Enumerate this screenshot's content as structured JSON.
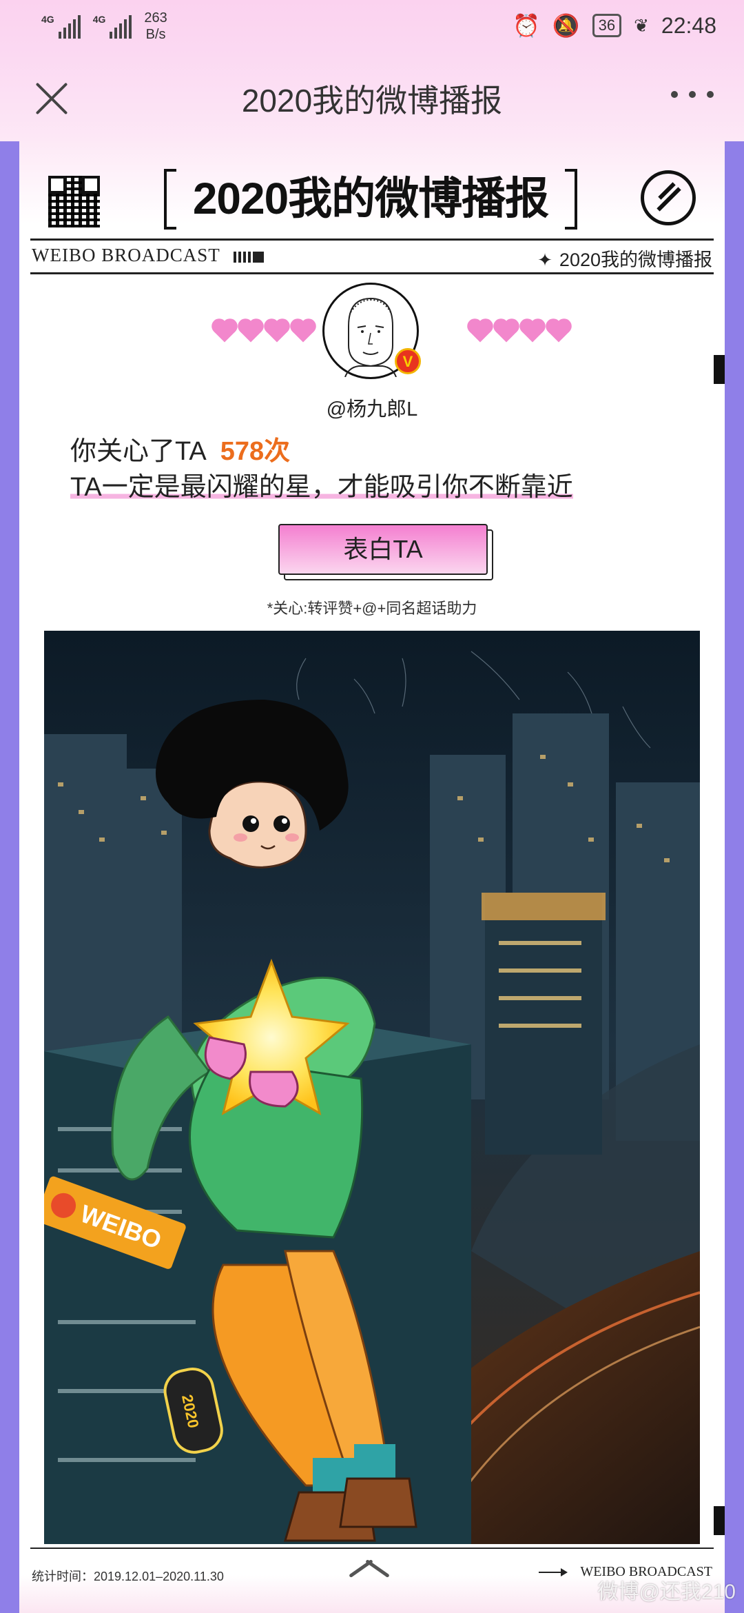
{
  "status_bar": {
    "signal1": "4G",
    "signal2": "4G",
    "speed_value": "263",
    "speed_unit": "B/s",
    "battery": "36",
    "time": "22:48"
  },
  "nav": {
    "title": "2020我的微博播报"
  },
  "header": {
    "title": "2020我的微博播报",
    "subtitle_en": "WEIBO BROADCAST",
    "subtitle_cn": "2020我的微博播报"
  },
  "profile": {
    "username": "@杨九郎L",
    "badge": "V"
  },
  "message": {
    "prefix": "你关心了TA",
    "count": "578次",
    "line2": "TA一定是最闪耀的星，才能吸引你不断靠近"
  },
  "cta": {
    "label": "表白TA",
    "note": "*关心:转评赞+@+同名超话助力"
  },
  "illustration": {
    "sign_text": "WEIBO",
    "badge_text": "2020"
  },
  "footer": {
    "stats": "统计时间：2019.12.01–2020.11.30",
    "brand": "WEIBO BROADCAST"
  },
  "watermark": "微博@还我210"
}
